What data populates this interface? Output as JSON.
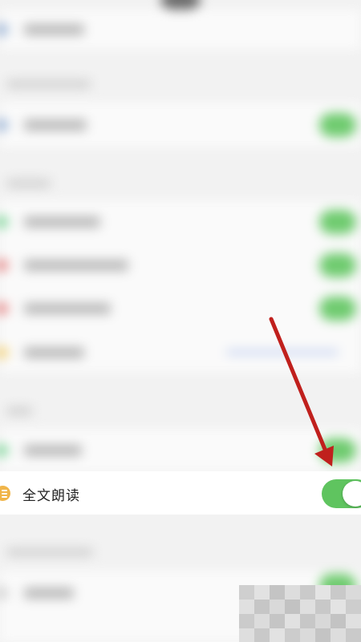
{
  "setting": {
    "label": "全文朗读",
    "enabled": true,
    "icon": "list-lines-icon",
    "icon_color": "#f0b54a",
    "toggle_color": "#5fc45f"
  },
  "annotation": {
    "arrow_color": "#c0201d"
  }
}
